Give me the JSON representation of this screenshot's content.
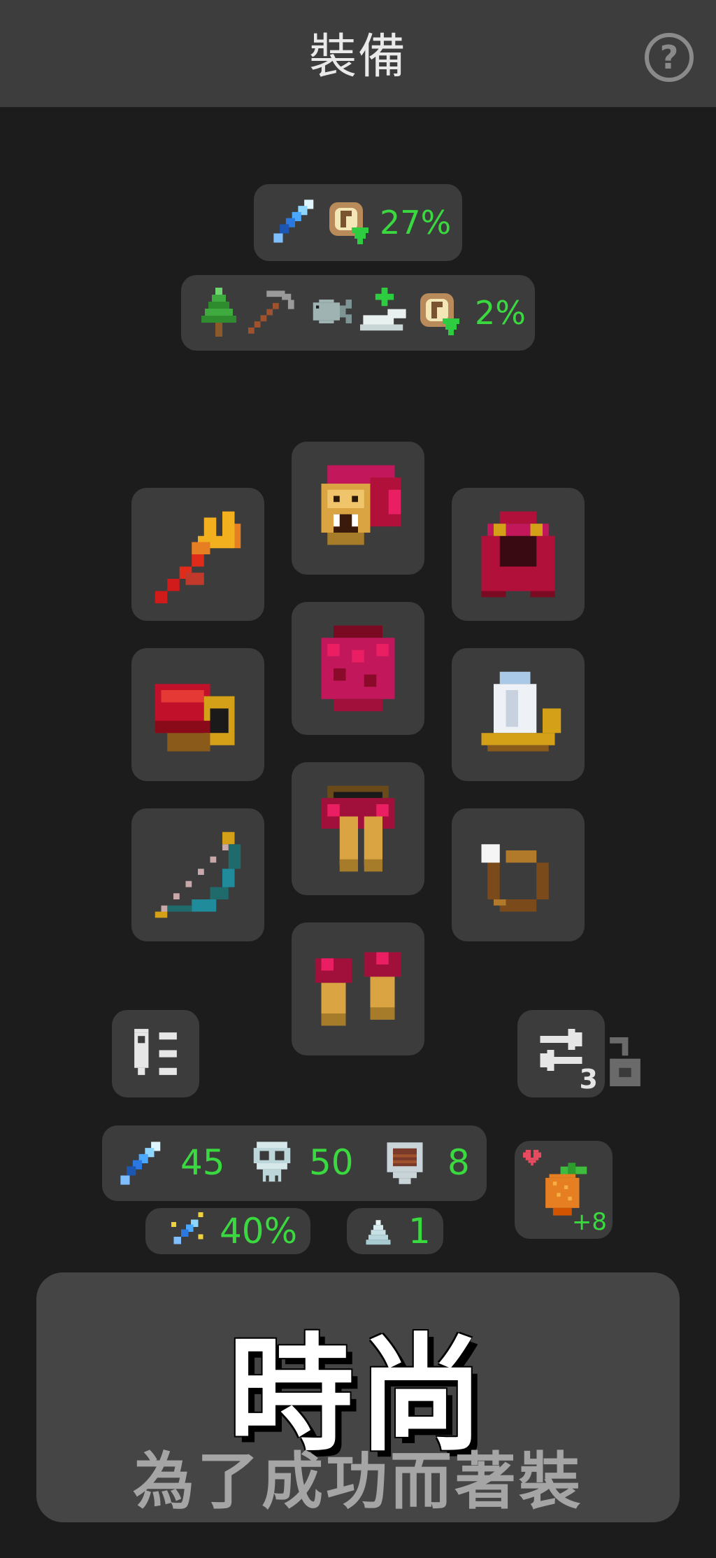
{
  "header": {
    "title": "裝備",
    "help_label": "?"
  },
  "bonus_combat": {
    "value": "27%"
  },
  "bonus_skilling": {
    "value": "2%"
  },
  "equipment_slots": [
    {
      "name": "weapon",
      "icon": "trident-icon"
    },
    {
      "name": "helmet",
      "icon": "lion-headdress-icon"
    },
    {
      "name": "cape",
      "icon": "red-hood-icon"
    },
    {
      "name": "gloves",
      "icon": "red-gauntlet-icon"
    },
    {
      "name": "body",
      "icon": "feather-armor-icon"
    },
    {
      "name": "amulet",
      "icon": "candle-tunic-icon"
    },
    {
      "name": "offhand",
      "icon": "bow-icon"
    },
    {
      "name": "legs",
      "icon": "feather-legs-icon"
    },
    {
      "name": "ring",
      "icon": "pearl-ring-icon"
    },
    {
      "name": "boots",
      "icon": "feather-boots-icon"
    }
  ],
  "loadout": {
    "count": "3"
  },
  "stats": {
    "attack": "45",
    "strength": "50",
    "defense": "8",
    "crit": "40%",
    "speed": "1"
  },
  "food": {
    "bonus": "+8"
  },
  "banner": {
    "title": "時尚",
    "subtitle": "為了成功而著裝"
  },
  "colors": {
    "accent_green": "#3ad93f",
    "panel": "#3c3c3c",
    "background": "#1c1c1c"
  }
}
